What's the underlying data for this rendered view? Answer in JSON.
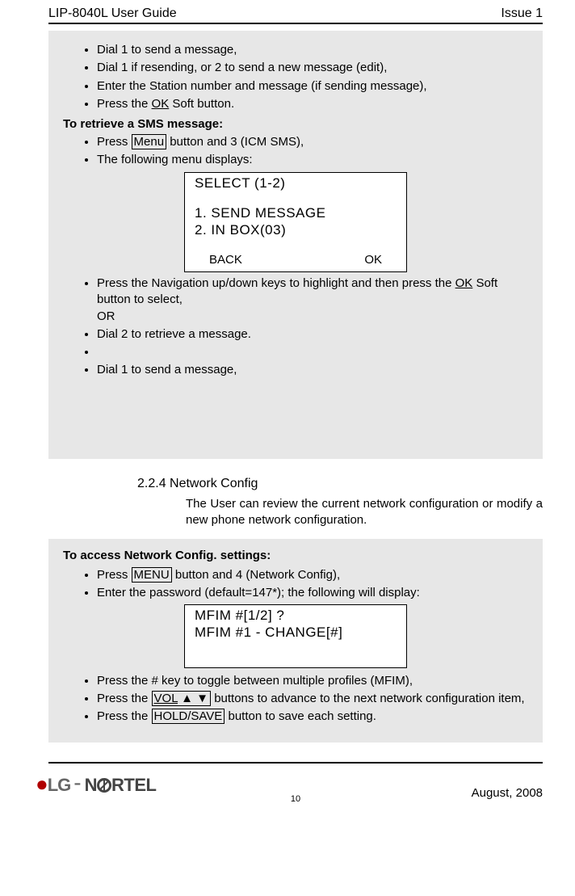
{
  "header": {
    "left": "LIP-8040L User Guide",
    "right": "Issue 1"
  },
  "box1": {
    "bullets_top": [
      "Dial 1 to send a message,",
      "Dial 1 if resending, or 2 to send a new message (edit),",
      "Enter the Station number and message (if sending message),"
    ],
    "press_ok_pre": "Press the ",
    "ok_txt": "OK",
    "press_ok_post": " Soft button.",
    "retrieve_heading": "To retrieve a SMS message:",
    "press_menu_pre": "Press ",
    "menu_label": "Menu",
    "press_menu_post": " button and 3 (ICM SMS),",
    "menu_displays": "The following menu displays:",
    "lcd": {
      "l1": "SELECT (1-2)",
      "l2": "1. SEND MESSAGE",
      "l3": "2. IN BOX(03)",
      "back": "BACK",
      "ok": "OK"
    },
    "nav_pre": "Press the Navigation up/down keys to highlight and then press the ",
    "nav_ok": "OK",
    "nav_post": " Soft button to select,",
    "or": "OR",
    "dial2": "Dial 2 to retrieve a message.",
    "empty": "",
    "dial1b": "Dial 1 to send a message,",
    "cutline": "Dial 1 if resending, or 2 to send a new message (edit),"
  },
  "section": {
    "num_title": "2.2.4  Network Config",
    "body": "The User can review the current network configuration or modify a new phone network configuration."
  },
  "box2": {
    "heading": "To access Network Config. settings:",
    "b1_pre": "Press ",
    "b1_menu": "Menu",
    "b1_post": " button and 4 (Network Config),",
    "b2": "Enter the password (default=147*); the following will display:",
    "lcd": {
      "l1": "MFIM #[1/2]  ?",
      "l2": "MFIM #1  - CHANGE[#]"
    },
    "b3": "Press the # key to toggle between multiple profiles (MFIM),",
    "b4_pre": "Press the ",
    "b4_vol": "VOL ▲ ▼",
    "b4_post": " buttons to advance to the next network configuration item,",
    "b5_pre": "Press the ",
    "b5_hs": "Hold/Save",
    "b5_post": " button to save each setting."
  },
  "footer": {
    "page": "10",
    "date": "August, 2008",
    "logo_lg": "LG",
    "logo_nortel_pre": "N",
    "logo_nortel_post": "RTEL"
  }
}
